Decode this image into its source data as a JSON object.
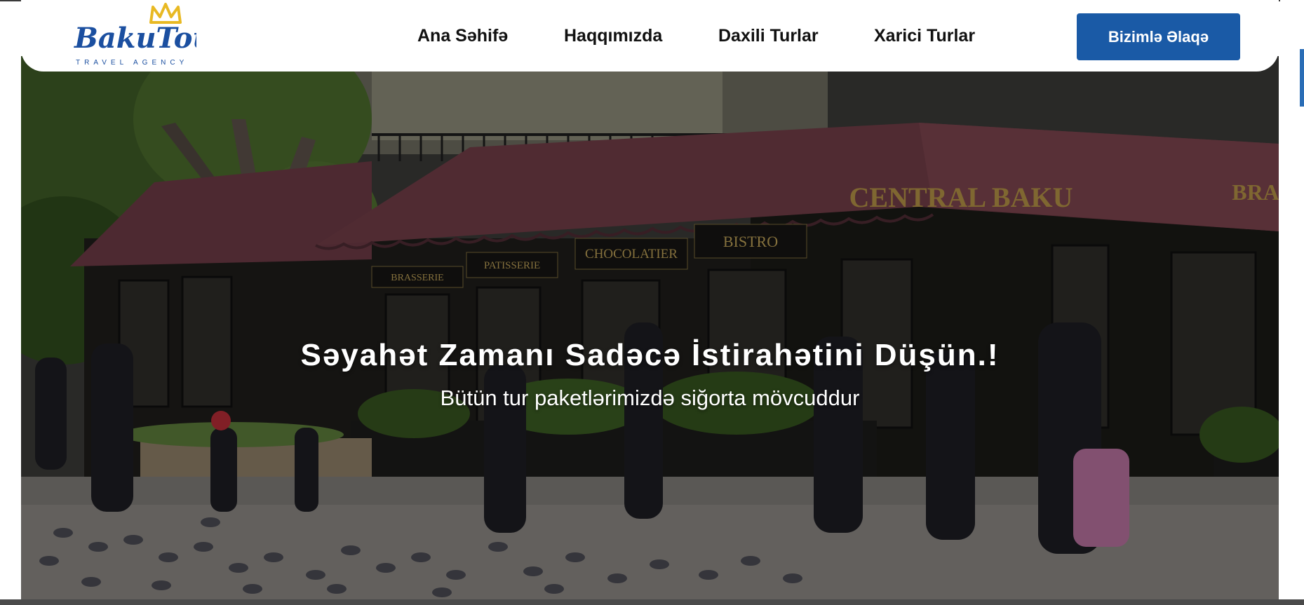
{
  "header": {
    "logo": {
      "brand_text": "BakuTour",
      "tagline": "TRAVEL AGENCY"
    },
    "nav": [
      {
        "label": "Ana Səhifə"
      },
      {
        "label": "Haqqımızda"
      },
      {
        "label": "Daxili Turlar"
      },
      {
        "label": "Xarici Turlar"
      }
    ],
    "contact_button": "Bizimlə Əlaqə"
  },
  "hero": {
    "title": "Səyahət Zamanı Sadəcə İstirahətini Düşün.!",
    "subtitle": "Bütün tur paketlərimizdə siğorta mövcuddur",
    "storefront_signs": [
      "BRASSERIE",
      "PATISSERIE",
      "CHOCOLATIER",
      "BISTRO",
      "CENTRAL BAKU",
      "BRA"
    ]
  },
  "colors": {
    "primary_button": "#1a5aa6",
    "logo_blue": "#1b4fa0",
    "logo_gold": "#e8b923",
    "awning": "#6b3a44",
    "nav_text": "#111111"
  }
}
